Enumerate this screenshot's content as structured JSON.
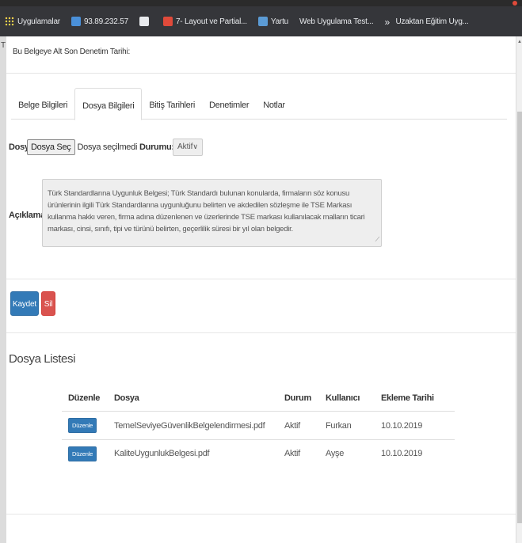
{
  "browser": {
    "bookmarks": [
      {
        "label": "Uygulamalar",
        "icon": "apps-icon"
      },
      {
        "label": "93.89.232.57",
        "icon": "computer-icon"
      },
      {
        "label": "",
        "icon": "shield-icon"
      },
      {
        "label": "7- Layout ve Partial...",
        "icon": "red-circle-icon"
      },
      {
        "label": "Yartu",
        "icon": "yartu-icon"
      },
      {
        "label": "Web Uygulama Test...",
        "icon": "none"
      },
      {
        "label": "Uzaktan Eğitim Uyg...",
        "icon": "arrow-icon"
      }
    ],
    "left_edge_char": "T"
  },
  "page": {
    "subtitle_note": "Bu Belgeye Alt Son Denetim Tarihi:",
    "tabs": [
      {
        "label": "Belge Bilgileri",
        "active": false
      },
      {
        "label": "Dosya Bilgileri",
        "active": true
      },
      {
        "label": "Bitiş Tarihleri",
        "active": false
      },
      {
        "label": "Denetimler",
        "active": false
      },
      {
        "label": "Notlar",
        "active": false
      }
    ],
    "form": {
      "file_label": "Dosya:",
      "file_button": "Dosya Seç",
      "file_status": "Dosya seçilmedi",
      "status_label": "Durumu:",
      "status_value": "Aktif",
      "desc_label": "Açıklama:",
      "desc_text": "Türk Standardlarına Uygunluk Belgesi; Türk Standardı bulunan konularda, firmaların söz konusu ürünlerinin ilgili Türk Standardlarına uygunluğunu belirten ve akdedilen sözleşme ile TSE Markası kullanma hakkı veren, firma adına düzenlenen ve üzerlerinde TSE markası kullanılacak malların ticari markası, cinsi, sınıfı, tipi ve türünü belirten, geçerlilik süresi bir yıl  olan belgedir."
    },
    "buttons": {
      "save": "Kaydet",
      "delete": "Sil"
    },
    "section_title": "Dosya Listesi",
    "table": {
      "headers": [
        "Düzenle",
        "Dosya",
        "Durum",
        "Kullanıcı",
        "Ekleme Tarihi"
      ],
      "rows": [
        {
          "edit": "Düzenle",
          "file": "TemelSeviyeGüvenlikBelgelendirmesi.pdf",
          "status": "Aktif",
          "user": "Furkan",
          "date": "10.10.2019"
        },
        {
          "edit": "Düzenle",
          "file": "KaliteUygunlukBelgesi.pdf",
          "status": "Aktif",
          "user": "Ayşe",
          "date": "10.10.2019"
        }
      ]
    },
    "colors": {
      "primary": "#337ab7",
      "danger": "#d9534f",
      "chrome": "#35363a"
    }
  }
}
